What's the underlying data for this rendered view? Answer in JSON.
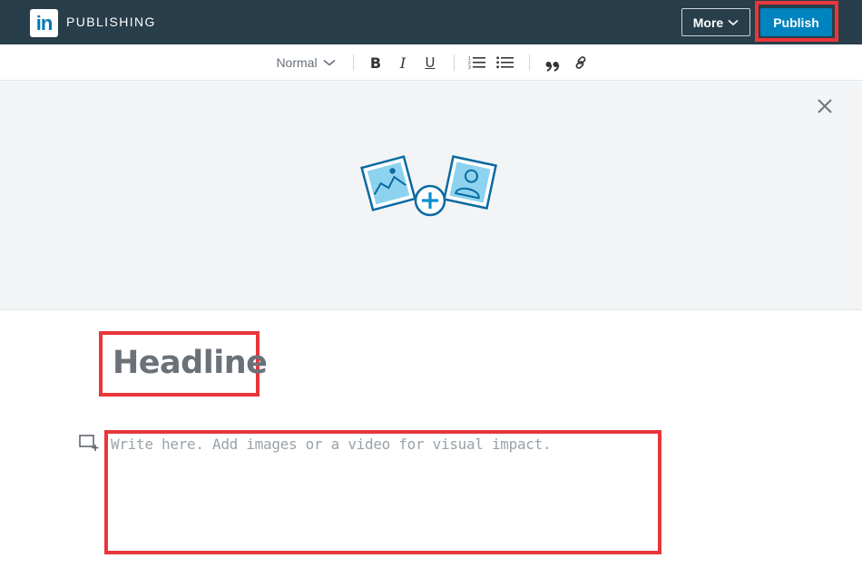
{
  "header": {
    "logo_text": "in",
    "brand": "PUBLISHING",
    "more_label": "More",
    "publish_label": "Publish"
  },
  "toolbar": {
    "style_select": "Normal",
    "bold": "B",
    "italic": "I",
    "underline": "U",
    "quote": "”"
  },
  "editor": {
    "headline_placeholder": "Headline",
    "body_placeholder": "Write here. Add images or a video for visual impact."
  },
  "colors": {
    "header_bg": "#283e4a",
    "publish_bg": "#0084bf",
    "highlight": "#e8363a",
    "icon_blue": "#0a6aa1",
    "icon_fill": "#8dd3ef"
  }
}
